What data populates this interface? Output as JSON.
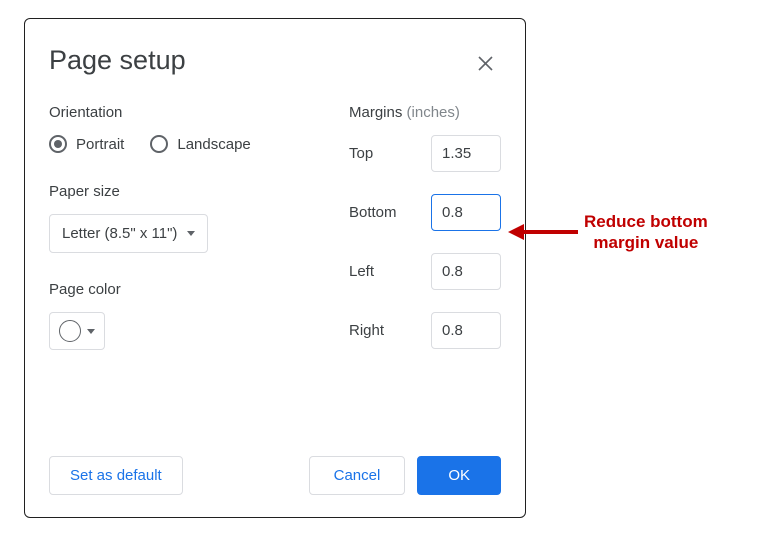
{
  "dialog": {
    "title": "Page setup",
    "orientation": {
      "label": "Orientation",
      "portrait": "Portrait",
      "landscape": "Landscape"
    },
    "paperSize": {
      "label": "Paper size",
      "selected": "Letter (8.5\" x 11\")"
    },
    "pageColor": {
      "label": "Page color"
    },
    "margins": {
      "label": "Margins",
      "units": "(inches)",
      "top": {
        "label": "Top",
        "value": "1.35"
      },
      "bottom": {
        "label": "Bottom",
        "value": "0.8"
      },
      "left": {
        "label": "Left",
        "value": "0.8"
      },
      "right": {
        "label": "Right",
        "value": "0.8"
      }
    },
    "buttons": {
      "setDefault": "Set as default",
      "cancel": "Cancel",
      "ok": "OK"
    }
  },
  "annotation": {
    "line1": "Reduce bottom",
    "line2": "margin value"
  }
}
